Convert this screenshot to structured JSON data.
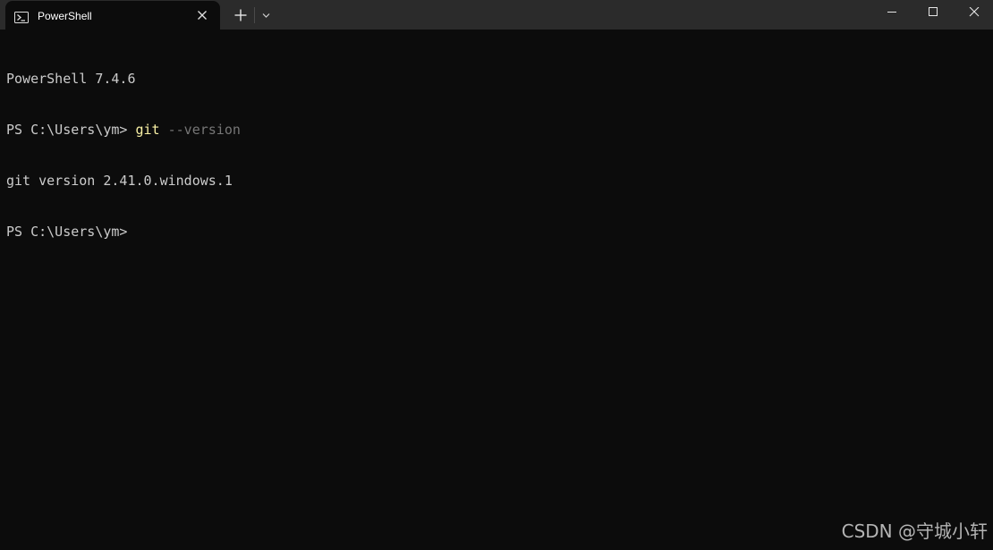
{
  "tab": {
    "title": "PowerShell",
    "icon": "powershell-icon"
  },
  "titlebar": {
    "new_tab_icon": "plus-icon",
    "dropdown_icon": "chevron-down-icon",
    "minimize_icon": "minimize-icon",
    "maximize_icon": "maximize-icon",
    "close_icon": "close-icon"
  },
  "terminal": {
    "banner": "PowerShell 7.4.6",
    "prompt1": "PS C:\\Users\\ym> ",
    "command": "git",
    "argument": " --version",
    "output": "git version 2.41.0.windows.1",
    "prompt2": "PS C:\\Users\\ym>"
  },
  "watermark": "CSDN @守城小轩",
  "colors": {
    "background": "#0c0c0c",
    "titlebar": "#2b2b2b",
    "text": "#cccccc",
    "command": "#f9f1a5",
    "parameter": "#767676"
  }
}
